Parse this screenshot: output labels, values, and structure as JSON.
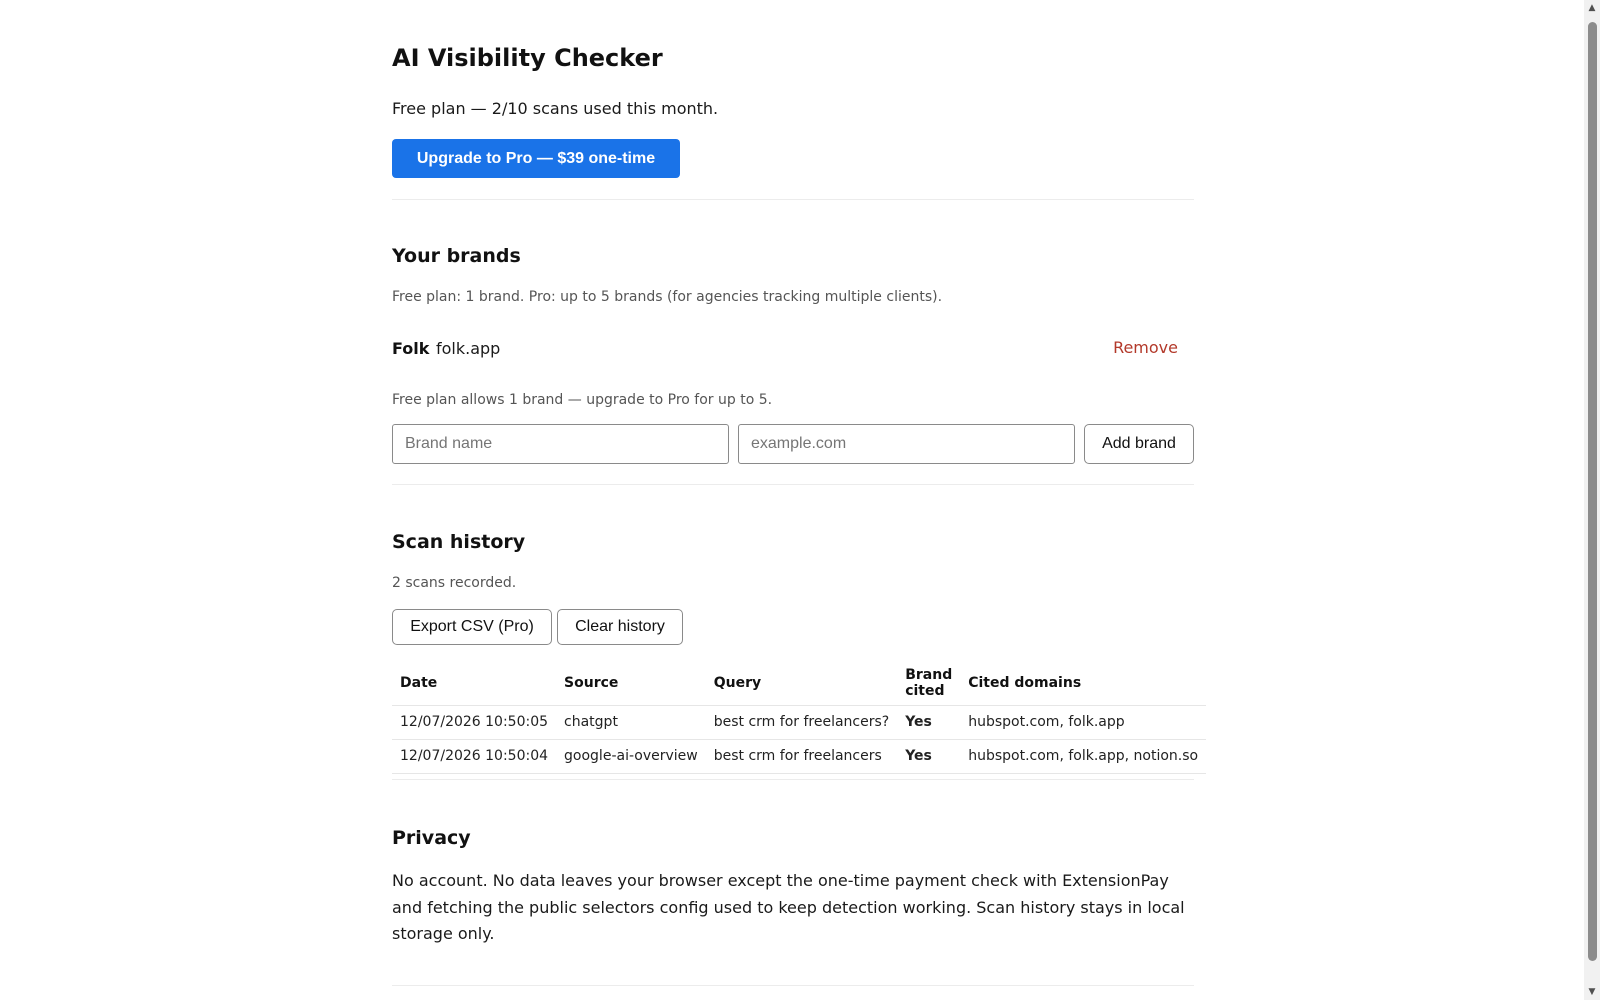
{
  "header": {
    "title": "AI Visibility Checker",
    "plan_status": "Free plan — 2/10 scans used this month.",
    "upgrade_label": "Upgrade to Pro — $39 one-time"
  },
  "brands": {
    "heading": "Your brands",
    "plan_note": "Free plan: 1 brand. Pro: up to 5 brands (for agencies tracking multiple clients).",
    "items": [
      {
        "name": "Folk",
        "domain": "folk.app",
        "remove_label": "Remove"
      }
    ],
    "limit_note": "Free plan allows 1 brand — upgrade to Pro for up to 5.",
    "name_input": {
      "placeholder": "Brand name",
      "value": ""
    },
    "domain_input": {
      "placeholder": "example.com",
      "value": ""
    },
    "add_label": "Add brand"
  },
  "history": {
    "heading": "Scan history",
    "count_note": "2 scans recorded.",
    "export_label": "Export CSV (Pro)",
    "clear_label": "Clear history",
    "columns": [
      "Date",
      "Source",
      "Query",
      "Brand cited",
      "Cited domains"
    ],
    "rows": [
      [
        "12/07/2026 10:50:05",
        "chatgpt",
        "best crm for freelancers?",
        "Yes",
        "hubspot.com, folk.app"
      ],
      [
        "12/07/2026 10:50:04",
        "google-ai-overview",
        "best crm for freelancers",
        "Yes",
        "hubspot.com, folk.app, notion.so"
      ]
    ]
  },
  "privacy": {
    "heading": "Privacy",
    "text": "No account. No data leaves your browser except the one-time payment check with ExtensionPay and fetching the public selectors config used to keep detection working. Scan history stays in local storage only."
  },
  "colors": {
    "primary": "#1a73e8",
    "remove": "#b3392a",
    "yes": "#1e7a3a"
  },
  "icons": {
    "scroll_up": "scroll-up-arrow-icon",
    "scroll_down": "scroll-down-arrow-icon"
  }
}
